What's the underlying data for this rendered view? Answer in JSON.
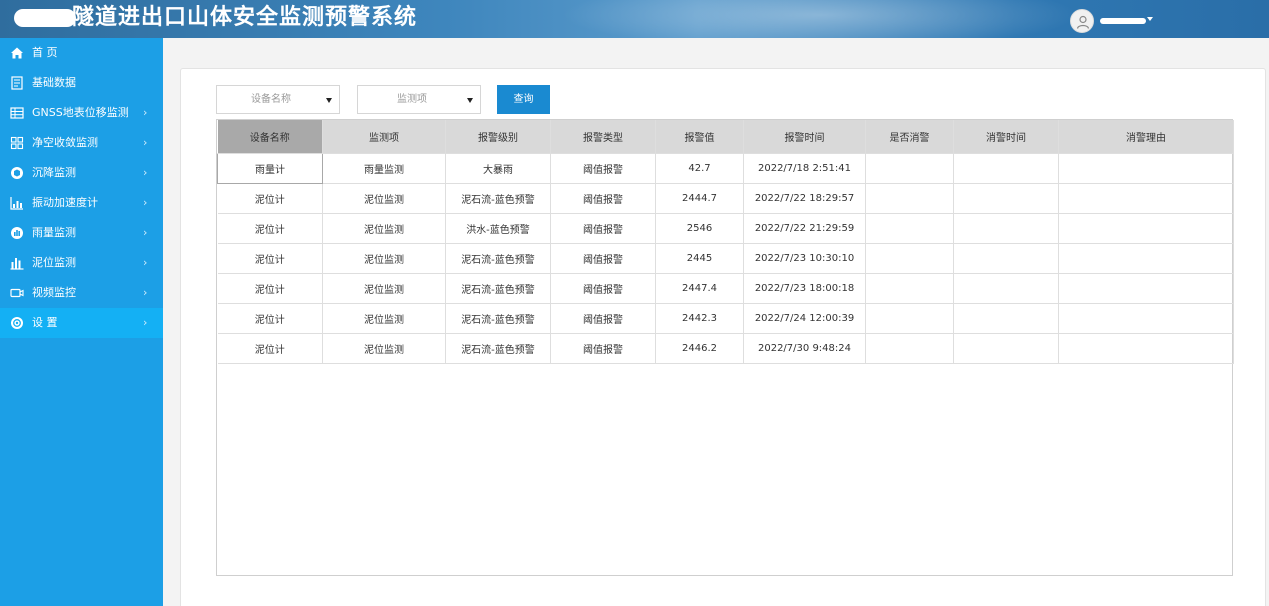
{
  "header": {
    "title": "隧道进出口山体安全监测预警系统"
  },
  "sidebar": {
    "items": [
      {
        "label": "首 页",
        "icon": "home-icon",
        "arrow": ""
      },
      {
        "label": "基础数据",
        "icon": "document-icon",
        "arrow": ""
      },
      {
        "label": "GNSS地表位移监测",
        "icon": "table-icon",
        "arrow": "›"
      },
      {
        "label": "净空收敛监测",
        "icon": "grid-icon",
        "arrow": "›"
      },
      {
        "label": "沉降监测",
        "icon": "cube-icon",
        "arrow": "›"
      },
      {
        "label": "振动加速度计",
        "icon": "chart-icon",
        "arrow": "›"
      },
      {
        "label": "雨量监测",
        "icon": "rain-gauge-icon",
        "arrow": "›"
      },
      {
        "label": "泥位监测",
        "icon": "bar-chart-icon",
        "arrow": "›"
      },
      {
        "label": "视频监控",
        "icon": "camera-icon",
        "arrow": "›"
      },
      {
        "label": "设 置",
        "icon": "gear-icon",
        "arrow": "›"
      }
    ]
  },
  "filters": {
    "device_placeholder": "设备名称",
    "item_placeholder": "监测项",
    "query_label": "查询"
  },
  "table": {
    "columns": [
      "设备名称",
      "监测项",
      "报警级别",
      "报警类型",
      "报警值",
      "报警时间",
      "是否消警",
      "消警时间",
      "消警理由"
    ],
    "rows": [
      [
        "雨量计",
        "雨量监测",
        "大暴雨",
        "阈值报警",
        "42.7",
        "2022/7/18 2:51:41",
        "",
        "",
        ""
      ],
      [
        "泥位计",
        "泥位监测",
        "泥石流-蓝色预警",
        "阈值报警",
        "2444.7",
        "2022/7/22 18:29:57",
        "",
        "",
        ""
      ],
      [
        "泥位计",
        "泥位监测",
        "洪水-蓝色预警",
        "阈值报警",
        "2546",
        "2022/7/22 21:29:59",
        "",
        "",
        ""
      ],
      [
        "泥位计",
        "泥位监测",
        "泥石流-蓝色预警",
        "阈值报警",
        "2445",
        "2022/7/23 10:30:10",
        "",
        "",
        ""
      ],
      [
        "泥位计",
        "泥位监测",
        "泥石流-蓝色预警",
        "阈值报警",
        "2447.4",
        "2022/7/23 18:00:18",
        "",
        "",
        ""
      ],
      [
        "泥位计",
        "泥位监测",
        "泥石流-蓝色预警",
        "阈值报警",
        "2442.3",
        "2022/7/24 12:00:39",
        "",
        "",
        ""
      ],
      [
        "泥位计",
        "泥位监测",
        "泥石流-蓝色预警",
        "阈值报警",
        "2446.2",
        "2022/7/30 9:48:24",
        "",
        "",
        ""
      ]
    ]
  },
  "colors": {
    "header": "#3e86bd",
    "sidebar": "#1c9fe6",
    "sidebar_active": "#14b0f4",
    "query_button": "#1a8ad1"
  }
}
